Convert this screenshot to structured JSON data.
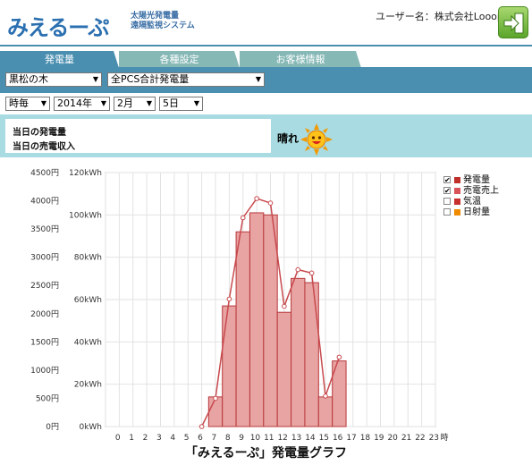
{
  "header": {
    "logo": "みえるーぷ",
    "logo_sub_1": "太陽光発電量",
    "logo_sub_2": "遠隔監視システム",
    "user_label": "ユーザー名：株式会社Looop"
  },
  "tabs": [
    {
      "label": "発電量",
      "active": true
    },
    {
      "label": "各種設定",
      "active": false
    },
    {
      "label": "お客様情報",
      "active": false
    }
  ],
  "site_select": "黒松の木",
  "pcs_select": "全PCS合計発電量",
  "period_select": "時毎",
  "year_select": "2014年",
  "month_select": "2月",
  "day_select": "5日",
  "info": {
    "gen_label": "当日の発電量",
    "sales_label": "当日の売電収入",
    "weather": "晴れ"
  },
  "legend": [
    {
      "label": "発電量",
      "checked": true,
      "color": "#c0302a"
    },
    {
      "label": "売電売上",
      "checked": true,
      "color": "#d8545a"
    },
    {
      "label": "気温",
      "checked": false,
      "color": "#c83030"
    },
    {
      "label": "日射量",
      "checked": false,
      "color": "#f08a00"
    }
  ],
  "chart_data": {
    "type": "bar",
    "title": "「みえるーぷ」発電量グラフ",
    "x_unit": "時",
    "categories": [
      "0",
      "1",
      "2",
      "3",
      "4",
      "5",
      "6",
      "7",
      "8",
      "9",
      "10",
      "11",
      "12",
      "13",
      "14",
      "15",
      "16",
      "17",
      "18",
      "19",
      "20",
      "21",
      "22",
      "23"
    ],
    "y_left_ticks": [
      "0円",
      "500円",
      "1000円",
      "1500円",
      "2000円",
      "2500円",
      "3000円",
      "3500円",
      "4000円",
      "4500円"
    ],
    "y_right_ticks": [
      "0kWh",
      "20kWh",
      "40kWh",
      "60kWh",
      "80kWh",
      "100kWh",
      "120kWh"
    ],
    "ylim_kwh": [
      0,
      120
    ],
    "ylim_yen": [
      0,
      4500
    ],
    "series": [
      {
        "name": "発電量",
        "unit": "kWh",
        "values": [
          0,
          0,
          0,
          0,
          0,
          0,
          0,
          14,
          57,
          92,
          101,
          100,
          54,
          70,
          68,
          14,
          31,
          0,
          0,
          0,
          0,
          0,
          0,
          0
        ]
      },
      {
        "name": "売電売上",
        "unit": "円",
        "values": [
          0,
          0,
          0,
          0,
          0,
          0,
          0,
          500,
          2260,
          3700,
          4040,
          3960,
          2130,
          2780,
          2720,
          540,
          1230,
          0,
          0,
          0,
          0,
          0,
          0,
          0
        ]
      }
    ]
  }
}
